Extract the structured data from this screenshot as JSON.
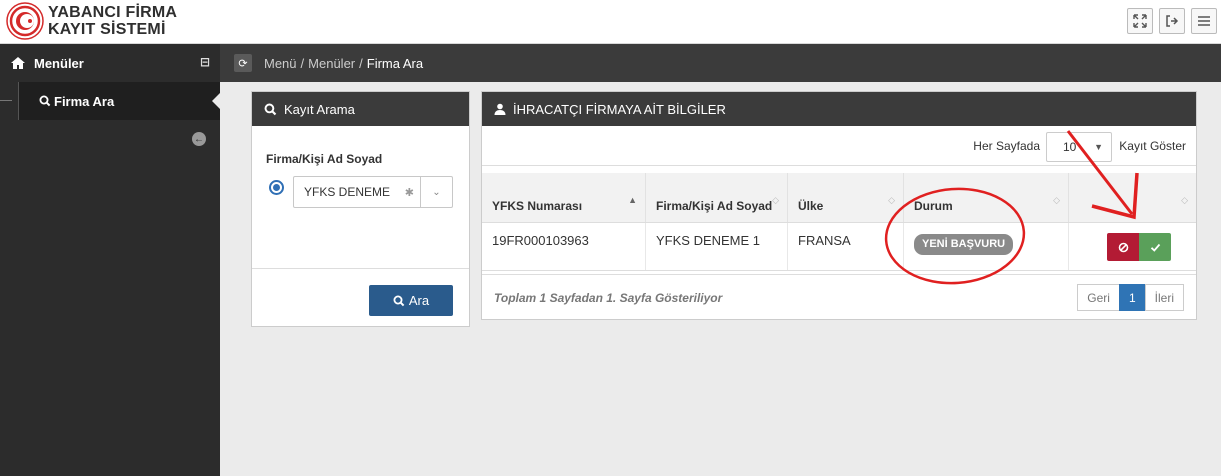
{
  "header": {
    "logo_line1": "YABANCI FİRMA",
    "logo_line2": "KAYIT SİSTEMİ",
    "actions": [
      "fullscreen-icon",
      "logout-icon",
      "menu-icon"
    ]
  },
  "sidebar": {
    "title": "Menüler",
    "items": [
      {
        "label": "Firma Ara",
        "icon": "search-icon"
      }
    ]
  },
  "breadcrumb": {
    "items": [
      "Menü",
      "Menüler"
    ],
    "current": "Firma Ara"
  },
  "search_panel": {
    "title": "Kayıt Arama",
    "field_label": "Firma/Kişi Ad Soyad",
    "combo_value": "YFKS DENEME",
    "button_label": "Ara"
  },
  "results_panel": {
    "title": "İHRACATÇI FİRMAYA AİT BİLGİLER",
    "page_size_label": "Her Sayfada",
    "page_size_value": "10",
    "page_size_suffix": "Kayıt Göster",
    "columns": [
      "YFKS Numarası",
      "Firma/Kişi Ad Soyad",
      "Ülke",
      "Durum",
      ""
    ],
    "rows": [
      {
        "number": "19FR000103963",
        "name": "YFKS DENEME 1",
        "country": "FRANSA",
        "status": "YENİ BAŞVURU"
      }
    ],
    "footer_info": "Toplam 1 Sayfadan 1. Sayfa Gösteriliyor",
    "pager": {
      "prev": "Geri",
      "current": "1",
      "next": "İleri"
    }
  },
  "colors": {
    "dark_bar": "#3b3b3b",
    "sidebar": "#2c2c2c",
    "primary": "#2a5b8c",
    "reject": "#b31b34",
    "approve": "#5aa05a",
    "annotation": "#e02020"
  }
}
